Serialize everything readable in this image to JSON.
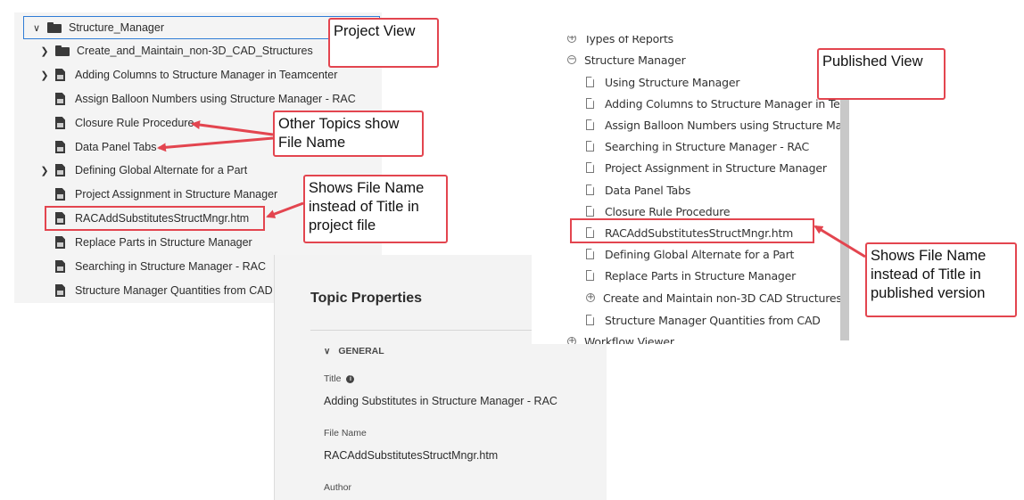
{
  "project_view": {
    "root": "Structure_Manager",
    "items": [
      {
        "label": "Create_and_Maintain_non-3D_CAD_Structures",
        "type": "folder",
        "expandable": true
      },
      {
        "label": "Adding Columns to Structure Manager in Teamcenter",
        "type": "doc",
        "expandable": true
      },
      {
        "label": "Assign Balloon Numbers using Structure Manager - RAC",
        "type": "doc",
        "expandable": false
      },
      {
        "label": "Closure Rule Procedure",
        "type": "doc",
        "expandable": false
      },
      {
        "label": "Data Panel Tabs",
        "type": "doc",
        "expandable": false
      },
      {
        "label": "Defining Global Alternate for a Part",
        "type": "doc",
        "expandable": true
      },
      {
        "label": "Project Assignment in Structure Manager",
        "type": "doc",
        "expandable": false
      },
      {
        "label": "RACAddSubstitutesStructMngr.htm",
        "type": "doc",
        "expandable": false
      },
      {
        "label": "Replace Parts in Structure Manager",
        "type": "doc",
        "expandable": false
      },
      {
        "label": "Searching in Structure Manager - RAC",
        "type": "doc",
        "expandable": false
      },
      {
        "label": "Structure Manager Quantities from CAD",
        "type": "doc",
        "expandable": false
      }
    ]
  },
  "callouts": {
    "project_view": "Project View",
    "other_topics": "Other Topics show File Name",
    "shows_file_project": "Shows File Name instead of Title in project file",
    "published_view": "Published View",
    "shows_file_published": "Shows File Name instead of Title in published version"
  },
  "published_view": {
    "top_partial": "Types of Reports",
    "group": "Structure Manager",
    "items": [
      {
        "label": "Using Structure Manager",
        "icon": "page"
      },
      {
        "label": "Adding Columns to Structure Manager in Tea",
        "icon": "page"
      },
      {
        "label": "Assign Balloon Numbers using Structure Man",
        "icon": "page"
      },
      {
        "label": "Searching in Structure Manager - RAC",
        "icon": "page"
      },
      {
        "label": "Project Assignment in Structure Manager",
        "icon": "page"
      },
      {
        "label": "Data Panel Tabs",
        "icon": "page"
      },
      {
        "label": "Closure Rule Procedure",
        "icon": "page"
      },
      {
        "label": "RACAddSubstitutesStructMngr.htm",
        "icon": "page"
      },
      {
        "label": "Defining Global Alternate for a Part",
        "icon": "page"
      },
      {
        "label": "Replace Parts in Structure Manager",
        "icon": "page"
      },
      {
        "label": "Create and Maintain non-3D CAD Structures",
        "icon": "plus"
      },
      {
        "label": "Structure Manager Quantities from CAD",
        "icon": "page"
      }
    ],
    "bottom": "Workflow Viewer"
  },
  "topic_properties": {
    "heading": "Topic Properties",
    "section": "GENERAL",
    "title_label": "Title",
    "title_value": "Adding Substitutes in Structure Manager - RAC",
    "filename_label": "File Name",
    "filename_value": "RACAddSubstitutesStructMngr.htm",
    "author_label": "Author"
  },
  "colors": {
    "callout_red": "#e3454f",
    "selection_blue": "#2f7cd6"
  }
}
